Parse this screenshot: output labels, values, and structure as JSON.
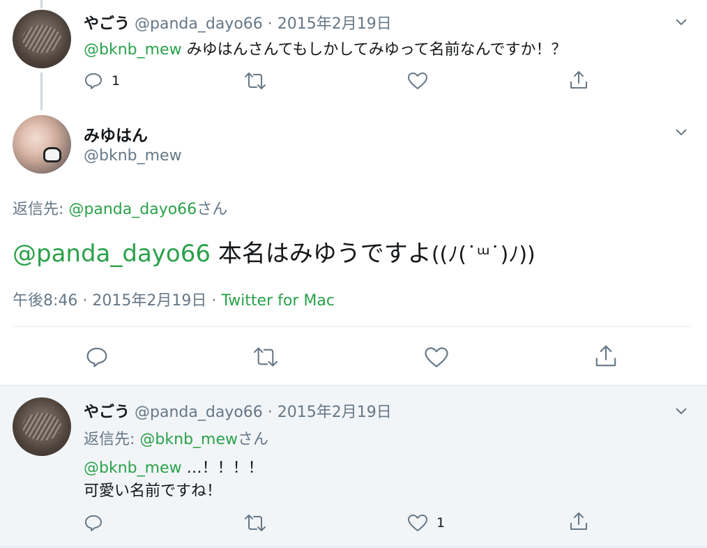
{
  "tweets": [
    {
      "display_name": "やごう",
      "handle": "@panda_dayo66",
      "separator": "·",
      "date": "2015年2月19日",
      "mention": "@bknb_mew",
      "text": "みゆはんさんてもしかしてみゆって名前なんですか！？",
      "reply_count": "1"
    },
    {
      "display_name": "みゆはん",
      "handle": "@bknb_mew",
      "reply_to_label": "返信先:",
      "reply_to_handle": "@panda_dayo66",
      "reply_to_suffix": "さん",
      "mention": "@panda_dayo66",
      "text": "本名はみゆうですよ",
      "emoticon": "((ﾉ(˙ᵚ˙)ﾉ))",
      "time": "午後8:46",
      "separator": "·",
      "date": "2015年2月19日",
      "source": "Twitter for Mac"
    },
    {
      "display_name": "やごう",
      "handle": "@panda_dayo66",
      "separator": "·",
      "date": "2015年2月19日",
      "reply_to_label": "返信先:",
      "reply_to_handle": "@bknb_mew",
      "reply_to_suffix": "さん",
      "mention": "@bknb_mew",
      "text_line1": "…！！！！",
      "text_line2": "可愛い名前ですね！",
      "like_count": "1"
    }
  ],
  "colors": {
    "link_green": "#2aa14a",
    "muted": "#657786",
    "text": "#14171a",
    "highlight_bg": "#f2f5f8",
    "divider": "#e6ecf0"
  },
  "icons": [
    "reply-icon",
    "retweet-icon",
    "like-icon",
    "share-icon",
    "chevron-down-icon"
  ]
}
